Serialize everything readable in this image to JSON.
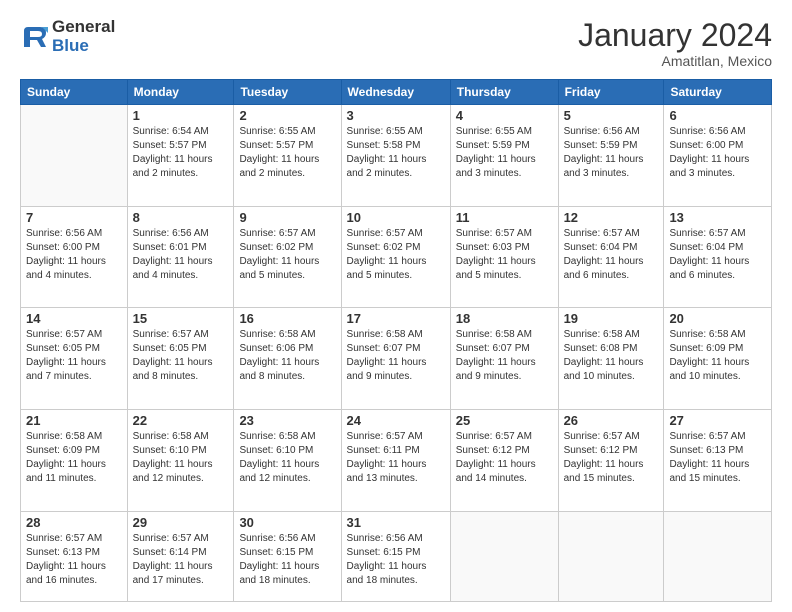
{
  "logo": {
    "general": "General",
    "blue": "Blue"
  },
  "title": "January 2024",
  "subtitle": "Amatitlan, Mexico",
  "days_of_week": [
    "Sunday",
    "Monday",
    "Tuesday",
    "Wednesday",
    "Thursday",
    "Friday",
    "Saturday"
  ],
  "weeks": [
    [
      {
        "day": "",
        "info": ""
      },
      {
        "day": "1",
        "info": "Sunrise: 6:54 AM\nSunset: 5:57 PM\nDaylight: 11 hours\nand 2 minutes."
      },
      {
        "day": "2",
        "info": "Sunrise: 6:55 AM\nSunset: 5:57 PM\nDaylight: 11 hours\nand 2 minutes."
      },
      {
        "day": "3",
        "info": "Sunrise: 6:55 AM\nSunset: 5:58 PM\nDaylight: 11 hours\nand 2 minutes."
      },
      {
        "day": "4",
        "info": "Sunrise: 6:55 AM\nSunset: 5:59 PM\nDaylight: 11 hours\nand 3 minutes."
      },
      {
        "day": "5",
        "info": "Sunrise: 6:56 AM\nSunset: 5:59 PM\nDaylight: 11 hours\nand 3 minutes."
      },
      {
        "day": "6",
        "info": "Sunrise: 6:56 AM\nSunset: 6:00 PM\nDaylight: 11 hours\nand 3 minutes."
      }
    ],
    [
      {
        "day": "7",
        "info": "Sunrise: 6:56 AM\nSunset: 6:00 PM\nDaylight: 11 hours\nand 4 minutes."
      },
      {
        "day": "8",
        "info": "Sunrise: 6:56 AM\nSunset: 6:01 PM\nDaylight: 11 hours\nand 4 minutes."
      },
      {
        "day": "9",
        "info": "Sunrise: 6:57 AM\nSunset: 6:02 PM\nDaylight: 11 hours\nand 5 minutes."
      },
      {
        "day": "10",
        "info": "Sunrise: 6:57 AM\nSunset: 6:02 PM\nDaylight: 11 hours\nand 5 minutes."
      },
      {
        "day": "11",
        "info": "Sunrise: 6:57 AM\nSunset: 6:03 PM\nDaylight: 11 hours\nand 5 minutes."
      },
      {
        "day": "12",
        "info": "Sunrise: 6:57 AM\nSunset: 6:04 PM\nDaylight: 11 hours\nand 6 minutes."
      },
      {
        "day": "13",
        "info": "Sunrise: 6:57 AM\nSunset: 6:04 PM\nDaylight: 11 hours\nand 6 minutes."
      }
    ],
    [
      {
        "day": "14",
        "info": "Sunrise: 6:57 AM\nSunset: 6:05 PM\nDaylight: 11 hours\nand 7 minutes."
      },
      {
        "day": "15",
        "info": "Sunrise: 6:57 AM\nSunset: 6:05 PM\nDaylight: 11 hours\nand 8 minutes."
      },
      {
        "day": "16",
        "info": "Sunrise: 6:58 AM\nSunset: 6:06 PM\nDaylight: 11 hours\nand 8 minutes."
      },
      {
        "day": "17",
        "info": "Sunrise: 6:58 AM\nSunset: 6:07 PM\nDaylight: 11 hours\nand 9 minutes."
      },
      {
        "day": "18",
        "info": "Sunrise: 6:58 AM\nSunset: 6:07 PM\nDaylight: 11 hours\nand 9 minutes."
      },
      {
        "day": "19",
        "info": "Sunrise: 6:58 AM\nSunset: 6:08 PM\nDaylight: 11 hours\nand 10 minutes."
      },
      {
        "day": "20",
        "info": "Sunrise: 6:58 AM\nSunset: 6:09 PM\nDaylight: 11 hours\nand 10 minutes."
      }
    ],
    [
      {
        "day": "21",
        "info": "Sunrise: 6:58 AM\nSunset: 6:09 PM\nDaylight: 11 hours\nand 11 minutes."
      },
      {
        "day": "22",
        "info": "Sunrise: 6:58 AM\nSunset: 6:10 PM\nDaylight: 11 hours\nand 12 minutes."
      },
      {
        "day": "23",
        "info": "Sunrise: 6:58 AM\nSunset: 6:10 PM\nDaylight: 11 hours\nand 12 minutes."
      },
      {
        "day": "24",
        "info": "Sunrise: 6:57 AM\nSunset: 6:11 PM\nDaylight: 11 hours\nand 13 minutes."
      },
      {
        "day": "25",
        "info": "Sunrise: 6:57 AM\nSunset: 6:12 PM\nDaylight: 11 hours\nand 14 minutes."
      },
      {
        "day": "26",
        "info": "Sunrise: 6:57 AM\nSunset: 6:12 PM\nDaylight: 11 hours\nand 15 minutes."
      },
      {
        "day": "27",
        "info": "Sunrise: 6:57 AM\nSunset: 6:13 PM\nDaylight: 11 hours\nand 15 minutes."
      }
    ],
    [
      {
        "day": "28",
        "info": "Sunrise: 6:57 AM\nSunset: 6:13 PM\nDaylight: 11 hours\nand 16 minutes."
      },
      {
        "day": "29",
        "info": "Sunrise: 6:57 AM\nSunset: 6:14 PM\nDaylight: 11 hours\nand 17 minutes."
      },
      {
        "day": "30",
        "info": "Sunrise: 6:56 AM\nSunset: 6:15 PM\nDaylight: 11 hours\nand 18 minutes."
      },
      {
        "day": "31",
        "info": "Sunrise: 6:56 AM\nSunset: 6:15 PM\nDaylight: 11 hours\nand 18 minutes."
      },
      {
        "day": "",
        "info": ""
      },
      {
        "day": "",
        "info": ""
      },
      {
        "day": "",
        "info": ""
      }
    ]
  ]
}
